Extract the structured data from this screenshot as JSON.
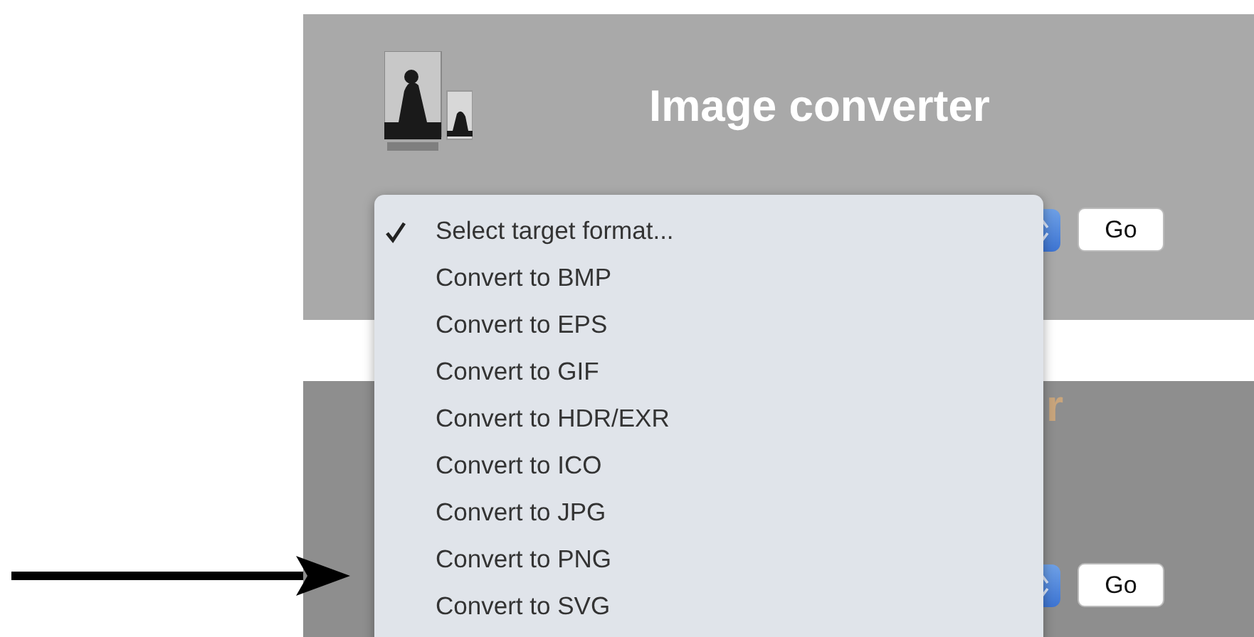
{
  "panels": [
    {
      "title": "Image converter",
      "button": "Go"
    },
    {
      "title": "r",
      "button": "Go"
    }
  ],
  "format_menu": {
    "items": [
      {
        "label": "Select target format...",
        "selected": true
      },
      {
        "label": "Convert to BMP",
        "selected": false
      },
      {
        "label": "Convert to EPS",
        "selected": false
      },
      {
        "label": "Convert to GIF",
        "selected": false
      },
      {
        "label": "Convert to HDR/EXR",
        "selected": false
      },
      {
        "label": "Convert to ICO",
        "selected": false
      },
      {
        "label": "Convert to JPG",
        "selected": false
      },
      {
        "label": "Convert to PNG",
        "selected": false
      },
      {
        "label": "Convert to SVG",
        "selected": false
      }
    ]
  }
}
